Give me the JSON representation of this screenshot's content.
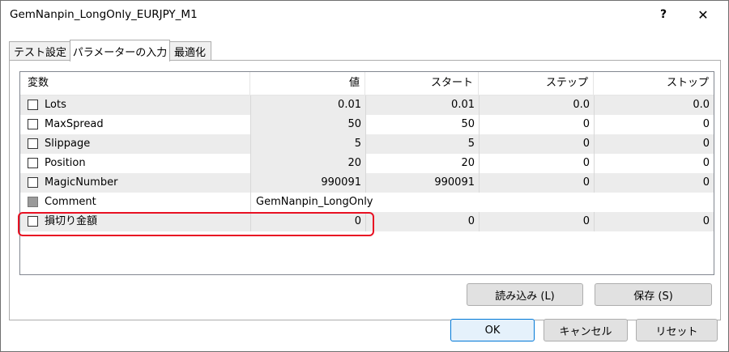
{
  "window": {
    "title": "GemNanpin_LongOnly_EURJPY_M1",
    "help_label": "?",
    "close_label": "✕"
  },
  "tabs": [
    {
      "label": "テスト設定",
      "active": false
    },
    {
      "label": "パラメーターの入力",
      "active": true
    },
    {
      "label": "最適化",
      "active": false
    }
  ],
  "table": {
    "headers": [
      "変数",
      "値",
      "スタート",
      "ステップ",
      "ストップ"
    ],
    "rows": [
      {
        "name": "Lots",
        "value": "0.01",
        "start": "0.01",
        "step": "0.0",
        "stop": "0.0",
        "checked": false
      },
      {
        "name": "MaxSpread",
        "value": "50",
        "start": "50",
        "step": "0",
        "stop": "0",
        "checked": false
      },
      {
        "name": "Slippage",
        "value": "5",
        "start": "5",
        "step": "0",
        "stop": "0",
        "checked": false
      },
      {
        "name": "Position",
        "value": "20",
        "start": "20",
        "step": "0",
        "stop": "0",
        "checked": false
      },
      {
        "name": "MagicNumber",
        "value": "990091",
        "start": "990091",
        "step": "0",
        "stop": "0",
        "checked": false
      },
      {
        "name": "Comment",
        "value": "GemNanpin_LongOnly",
        "checked": false,
        "disabled": true
      },
      {
        "name": "損切り金額",
        "value": "0",
        "start": "0",
        "step": "0",
        "stop": "0",
        "checked": false
      }
    ]
  },
  "buttons": {
    "load": "読み込み (L)",
    "save": "保存 (S)",
    "ok": "OK",
    "cancel": "キャンセル",
    "reset": "リセット"
  },
  "colors": {
    "highlight": "#e81123",
    "row_alt": "#ececec",
    "primary_border": "#0078d7"
  }
}
